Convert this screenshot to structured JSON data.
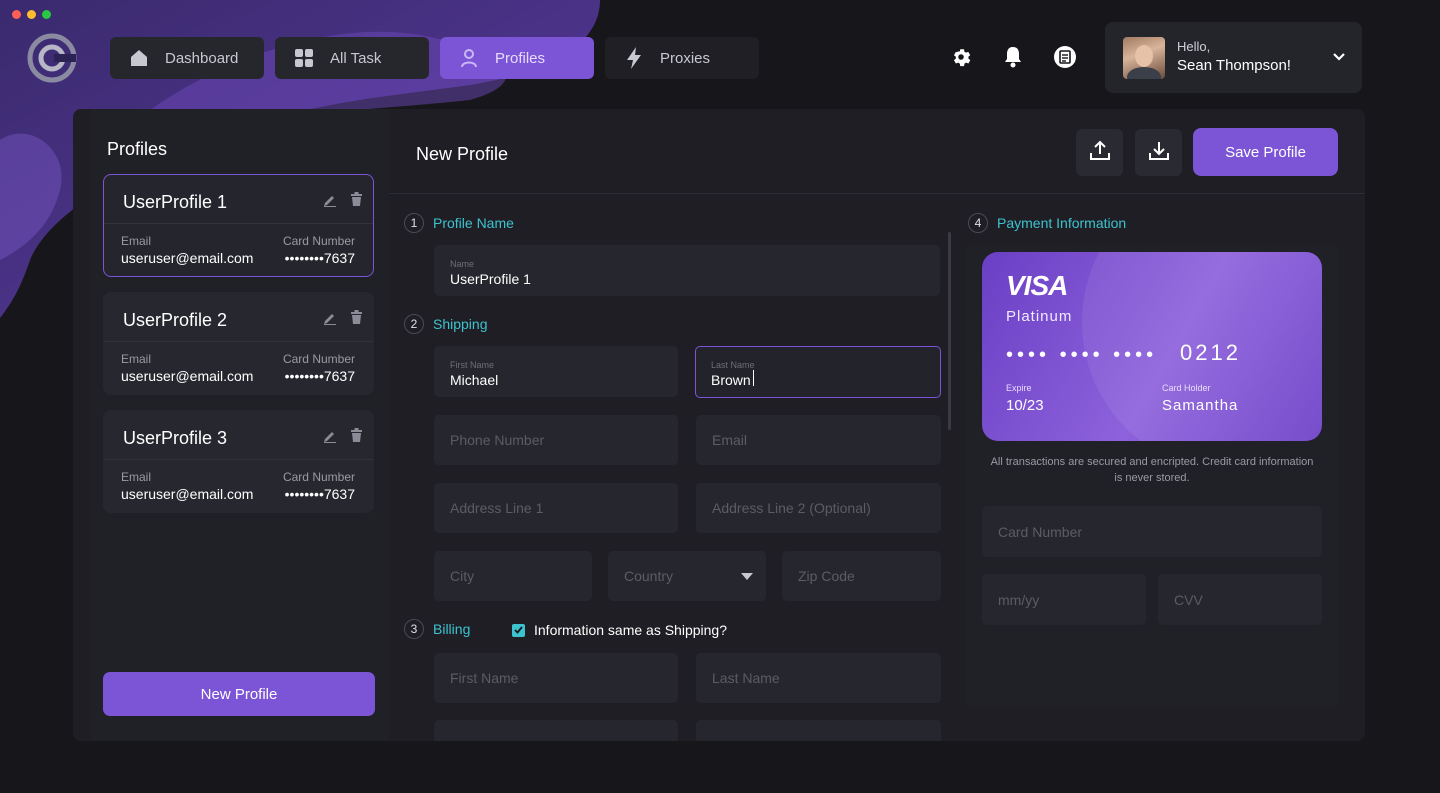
{
  "window": {
    "traffic_colors": [
      "#ff5f57",
      "#febc2e",
      "#28c840"
    ]
  },
  "nav": {
    "items": [
      {
        "label": "Dashboard",
        "icon": "home-icon"
      },
      {
        "label": "All Task",
        "icon": "grid-icon"
      },
      {
        "label": "Profiles",
        "icon": "user-icon",
        "active": true
      },
      {
        "label": "Proxies",
        "icon": "lightning-icon"
      }
    ]
  },
  "top_icons": [
    "gear-icon",
    "bell-icon",
    "document-icon"
  ],
  "user": {
    "greeting": "Hello,",
    "name": "Sean Thompson!"
  },
  "sidebar": {
    "title": "Profiles",
    "profiles": [
      {
        "name": "UserProfile 1",
        "email_label": "Email",
        "email": "useruser@email.com",
        "card_label": "Card Number",
        "card": "••••••••7637"
      },
      {
        "name": "UserProfile 2",
        "email_label": "Email",
        "email": "useruser@email.com",
        "card_label": "Card Number",
        "card": "••••••••7637"
      },
      {
        "name": "UserProfile 3",
        "email_label": "Email",
        "email": "useruser@email.com",
        "card_label": "Card Number",
        "card": "••••••••7637"
      }
    ],
    "new_button": "New Profile"
  },
  "editor": {
    "title": "New Profile",
    "save_button": "Save Profile",
    "sections": {
      "profile": {
        "num": "1",
        "title": "Profile Name"
      },
      "shipping": {
        "num": "2",
        "title": "Shipping"
      },
      "billing": {
        "num": "3",
        "title": "Billing"
      },
      "payment": {
        "num": "4",
        "title": "Payment Information"
      }
    },
    "fields": {
      "name": {
        "label": "Name",
        "value": "UserProfile 1"
      },
      "first_name": {
        "label": "First Name",
        "value": "Michael"
      },
      "last_name": {
        "label": "Last Name",
        "value": "Brown"
      },
      "phone": {
        "placeholder": "Phone Number"
      },
      "email": {
        "placeholder": "Email"
      },
      "address1": {
        "placeholder": "Address Line 1"
      },
      "address2": {
        "placeholder": "Address Line 2 (Optional)"
      },
      "city": {
        "placeholder": "City"
      },
      "country": {
        "placeholder": "Country"
      },
      "zip": {
        "placeholder": "Zip Code"
      },
      "billing_first": {
        "placeholder": "First Name"
      },
      "billing_last": {
        "placeholder": "Last Name"
      }
    },
    "same_as_shipping": {
      "label": "Information same as Shipping?",
      "checked": true
    }
  },
  "payment": {
    "card": {
      "brand": "VISA",
      "tier": "Platinum",
      "masked": "•••• •••• ••••",
      "last4": "0212",
      "expire_label": "Expire",
      "expire": "10/23",
      "holder_label": "Card Holder",
      "holder": "Samantha"
    },
    "secure_note": "All transactions are secured and encripted. Credit card information is never stored.",
    "card_number_placeholder": "Card Number",
    "expiry_placeholder": "mm/yy",
    "cvv_placeholder": "CVV"
  },
  "colors": {
    "accent": "#7b55d6",
    "teal": "#3dc3d0",
    "background": "#17171b"
  }
}
